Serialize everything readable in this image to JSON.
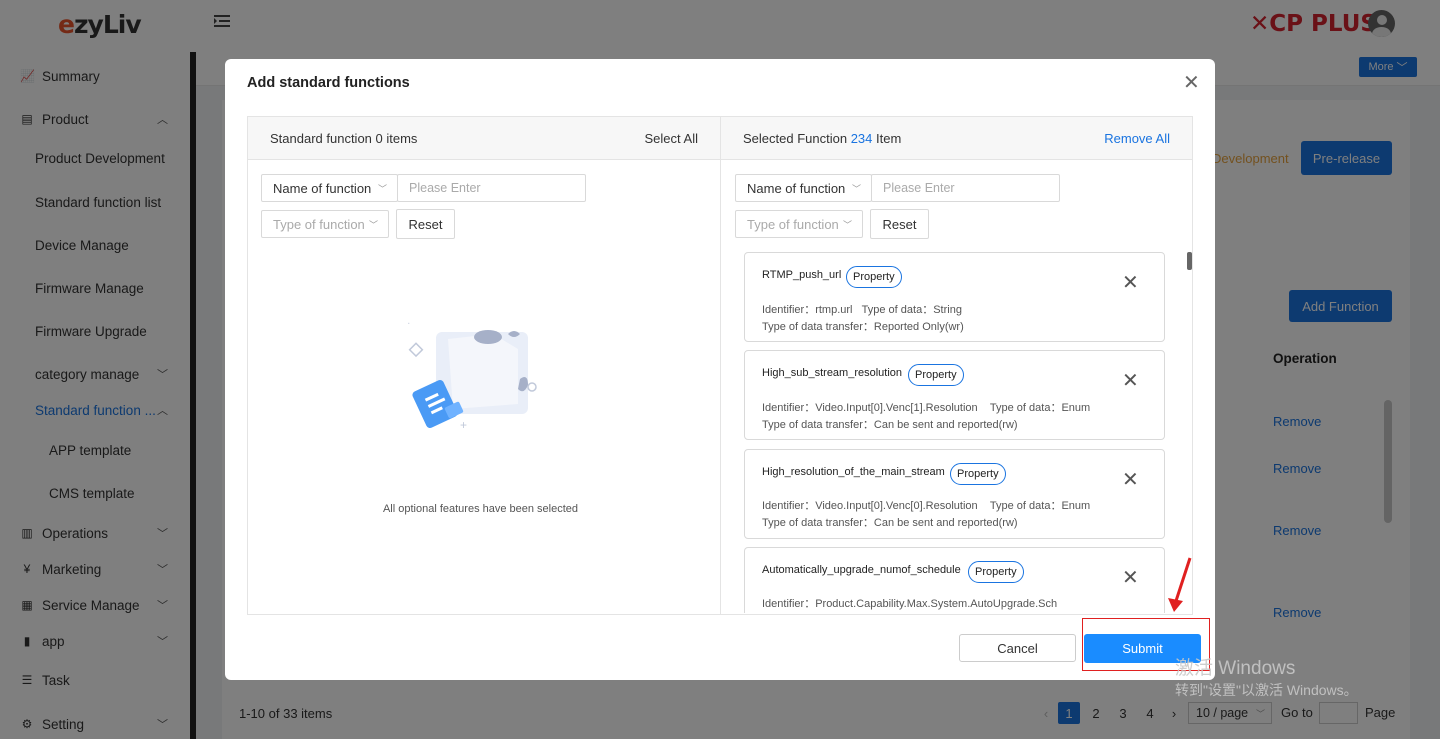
{
  "header": {
    "logo_text_e": "e",
    "logo_text_rest": "zyLiv",
    "brand": "✕CP PLUS"
  },
  "sidebar": {
    "items": [
      {
        "label": "Summary",
        "icon": "chart-icon"
      },
      {
        "label": "Product",
        "icon": "document-icon"
      },
      {
        "label": "Product Development"
      },
      {
        "label": "Standard function list"
      },
      {
        "label": "Device Manage"
      },
      {
        "label": "Firmware Manage"
      },
      {
        "label": "Firmware Upgrade"
      },
      {
        "label": "category manage"
      },
      {
        "label": "Standard function ..."
      },
      {
        "label": "APP template"
      },
      {
        "label": "CMS template"
      },
      {
        "label": "Operations",
        "icon": "bar-chart-icon"
      },
      {
        "label": "Marketing",
        "icon": "yen-icon"
      },
      {
        "label": "Service Manage",
        "icon": "grid-icon"
      },
      {
        "label": "app",
        "icon": "app-icon"
      },
      {
        "label": "Task",
        "icon": "list-icon"
      },
      {
        "label": "Setting",
        "icon": "gear-icon"
      }
    ]
  },
  "background": {
    "more_label": "More",
    "dev_text": "Development",
    "prerelease_label": "Pre-release",
    "add_function_label": "Add Function",
    "operation_header": "Operation",
    "remove_label": "Remove",
    "pager_summary": "1-10 of 33 items",
    "pages": [
      "1",
      "2",
      "3",
      "4"
    ],
    "current_page": "1",
    "page_size": "10 / page",
    "goto_label": "Go to",
    "page_label": "Page"
  },
  "modal": {
    "title": "Add standard functions",
    "left": {
      "header_prefix": "Standard function ",
      "header_count": "0",
      "header_suffix": " items",
      "select_all": "Select All",
      "name_select": "Name of function",
      "search_placeholder": "Please Enter",
      "type_select": "Type of function",
      "reset": "Reset",
      "empty_text": "All optional features have been selected"
    },
    "right": {
      "header_prefix": "Selected Function ",
      "header_count": "234",
      "header_suffix": " Item",
      "remove_all": "Remove All",
      "name_select": "Name of function",
      "search_placeholder": "Please Enter",
      "type_select": "Type of function",
      "reset": "Reset",
      "cards": [
        {
          "name": "RTMP_push_url",
          "tag": "Property",
          "identifier": "Identifier：rtmp.url",
          "data_type": "Type of data：String",
          "transfer": "Type of data transfer：Reported Only(wr)"
        },
        {
          "name": "High_sub_stream_resolution",
          "tag": "Property",
          "identifier": "Identifier：Video.Input[0].Venc[1].Resolution",
          "data_type": "Type of data：Enum",
          "transfer": "Type of data transfer：Can be sent and reported(rw)"
        },
        {
          "name": "High_resolution_of_the_main_stream",
          "tag": "Property",
          "identifier": "Identifier：Video.Input[0].Venc[0].Resolution",
          "data_type": "Type of data：Enum",
          "transfer": "Type of data transfer：Can be sent and reported(rw)"
        },
        {
          "name": "Automatically_upgrade_numof_schedule",
          "tag": "Property",
          "identifier": "Identifier：Product.Capability.Max.System.AutoUpgrade.Sch",
          "data_type": "",
          "transfer": ""
        }
      ]
    },
    "cancel": "Cancel",
    "submit": "Submit"
  },
  "watermark": {
    "line1": "激活 Windows",
    "line2": "转到\"设置\"以激活 Windows。"
  },
  "colors": {
    "accent": "#1a74e0",
    "submit": "#1a8cff",
    "highlight": "#e02020"
  }
}
